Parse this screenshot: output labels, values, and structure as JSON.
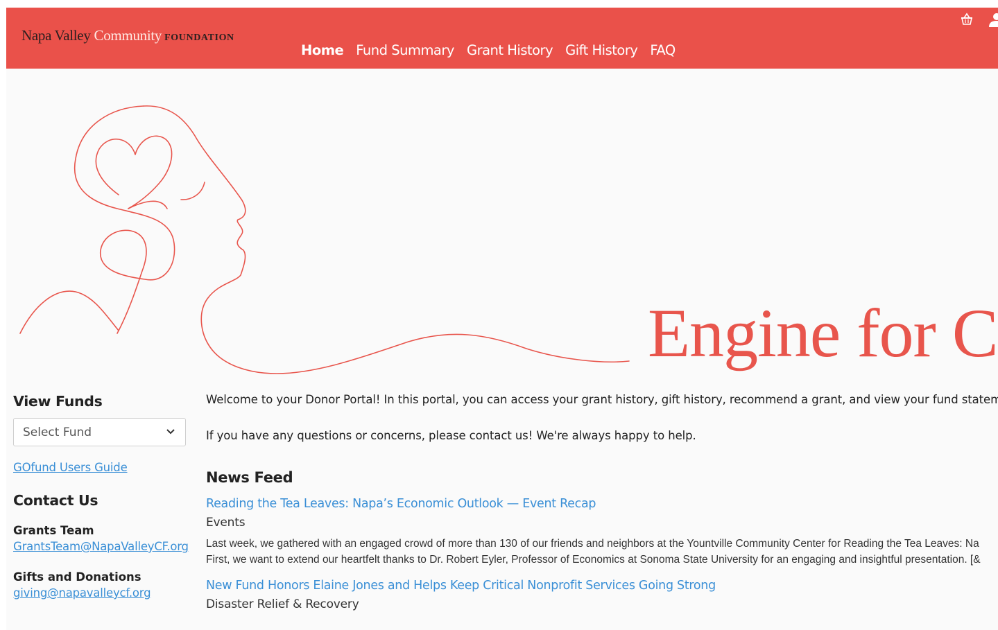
{
  "header": {
    "logo": {
      "part1": "Napa Valley ",
      "part2": "Community",
      "part3": "FOUNDATION"
    },
    "nav": [
      {
        "label": "Home",
        "active": true
      },
      {
        "label": "Fund Summary"
      },
      {
        "label": "Grant History"
      },
      {
        "label": "Gift History"
      },
      {
        "label": "FAQ"
      }
    ],
    "icons": [
      "basket-icon",
      "user-icon"
    ],
    "color": "#ea514a"
  },
  "hero": {
    "title": "Engine for C",
    "accent_color": "#e8554c"
  },
  "sidebar": {
    "view_funds_heading": "View Funds",
    "select_fund": {
      "placeholder": "Select Fund"
    },
    "guide_link": "GOfund Users Guide",
    "contact_heading": "Contact Us",
    "contacts": [
      {
        "label": "Grants Team",
        "email": "GrantsTeam@NapaValleyCF.org"
      },
      {
        "label": "Gifts and Donations",
        "email": "giving@napavalleycf.org"
      }
    ]
  },
  "main": {
    "welcome": "Welcome to your Donor Portal! In this portal, you can access your grant history, gift history, recommend a grant, and view your fund statem",
    "questions": "If you have any questions or concerns, please contact us! We're always happy to help.",
    "news_heading": "News Feed",
    "news": [
      {
        "title": "Reading the Tea Leaves: Napa’s Economic Outlook — Event Recap",
        "category": "Events",
        "body1": "Last week, we gathered with an engaged crowd of more than 130 of our friends and neighbors at the Yountville Community Center for Reading the Tea Leaves: Na",
        "body2": "First, we want to extend our heartfelt thanks to Dr. Robert Eyler, Professor of Economics at Sonoma State University for an engaging and insightful presentation. [&"
      },
      {
        "title": "New Fund Honors Elaine Jones and Helps Keep Critical Nonprofit Services Going Strong",
        "category": "Disaster Relief & Recovery"
      }
    ]
  }
}
